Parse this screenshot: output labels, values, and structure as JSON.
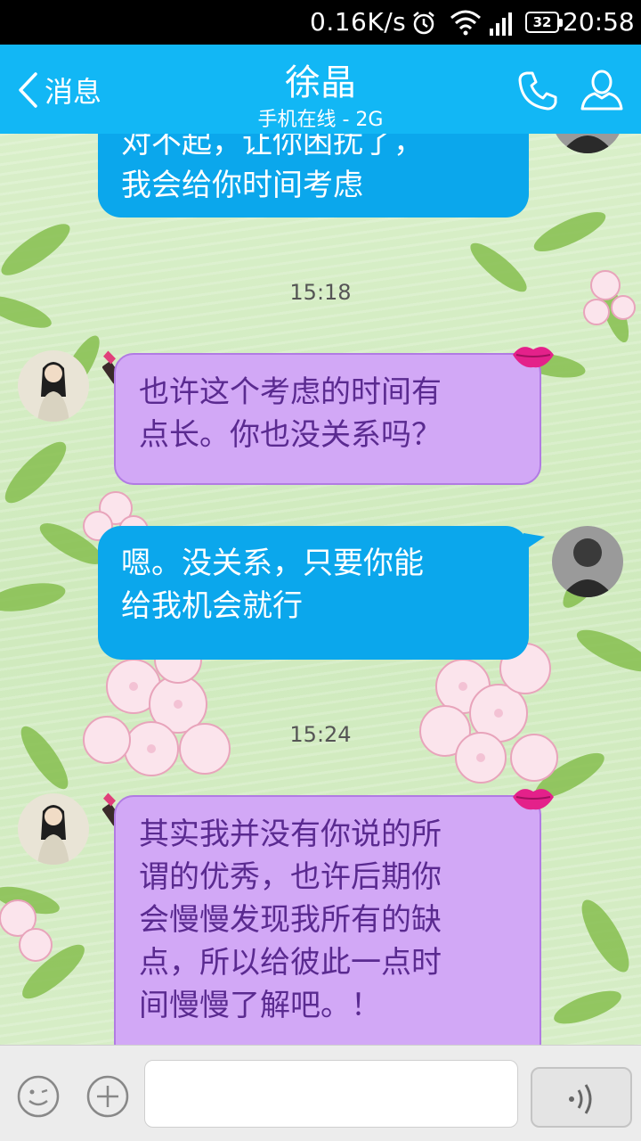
{
  "status_bar": {
    "net_speed": "0.16K/s",
    "battery": "32",
    "time": "20:58"
  },
  "header": {
    "back_label": "消息",
    "contact_name": "徐晶",
    "contact_status": "手机在线 - 2G"
  },
  "messages": [
    {
      "side": "out",
      "text_line1": "对不起，让你困扰了，",
      "text_line2": "我会给你时间考虑"
    },
    {
      "side": "time",
      "text": "15:18"
    },
    {
      "side": "in",
      "text_line1": "也许这个考虑的时间有",
      "text_line2": "点长。你也没关系吗？"
    },
    {
      "side": "out",
      "text_line1": "嗯。没关系，只要你能",
      "text_line2": "给我机会就行"
    },
    {
      "side": "time",
      "text": "15:24"
    },
    {
      "side": "in",
      "text_line1": "其实我并没有你说的所",
      "text_line2": "谓的优秀，也许后期你",
      "text_line3": "会慢慢发现我所有的缺",
      "text_line4": "点，所以给彼此一点时",
      "text_line5": "间慢慢了解吧。！"
    }
  ],
  "input": {
    "placeholder": "",
    "value": ""
  },
  "colors": {
    "header": "#12b7f5",
    "bubble_out": "#0ba7ec",
    "bubble_in": "#d2a8f6",
    "bubble_in_text": "#5a2a90"
  }
}
